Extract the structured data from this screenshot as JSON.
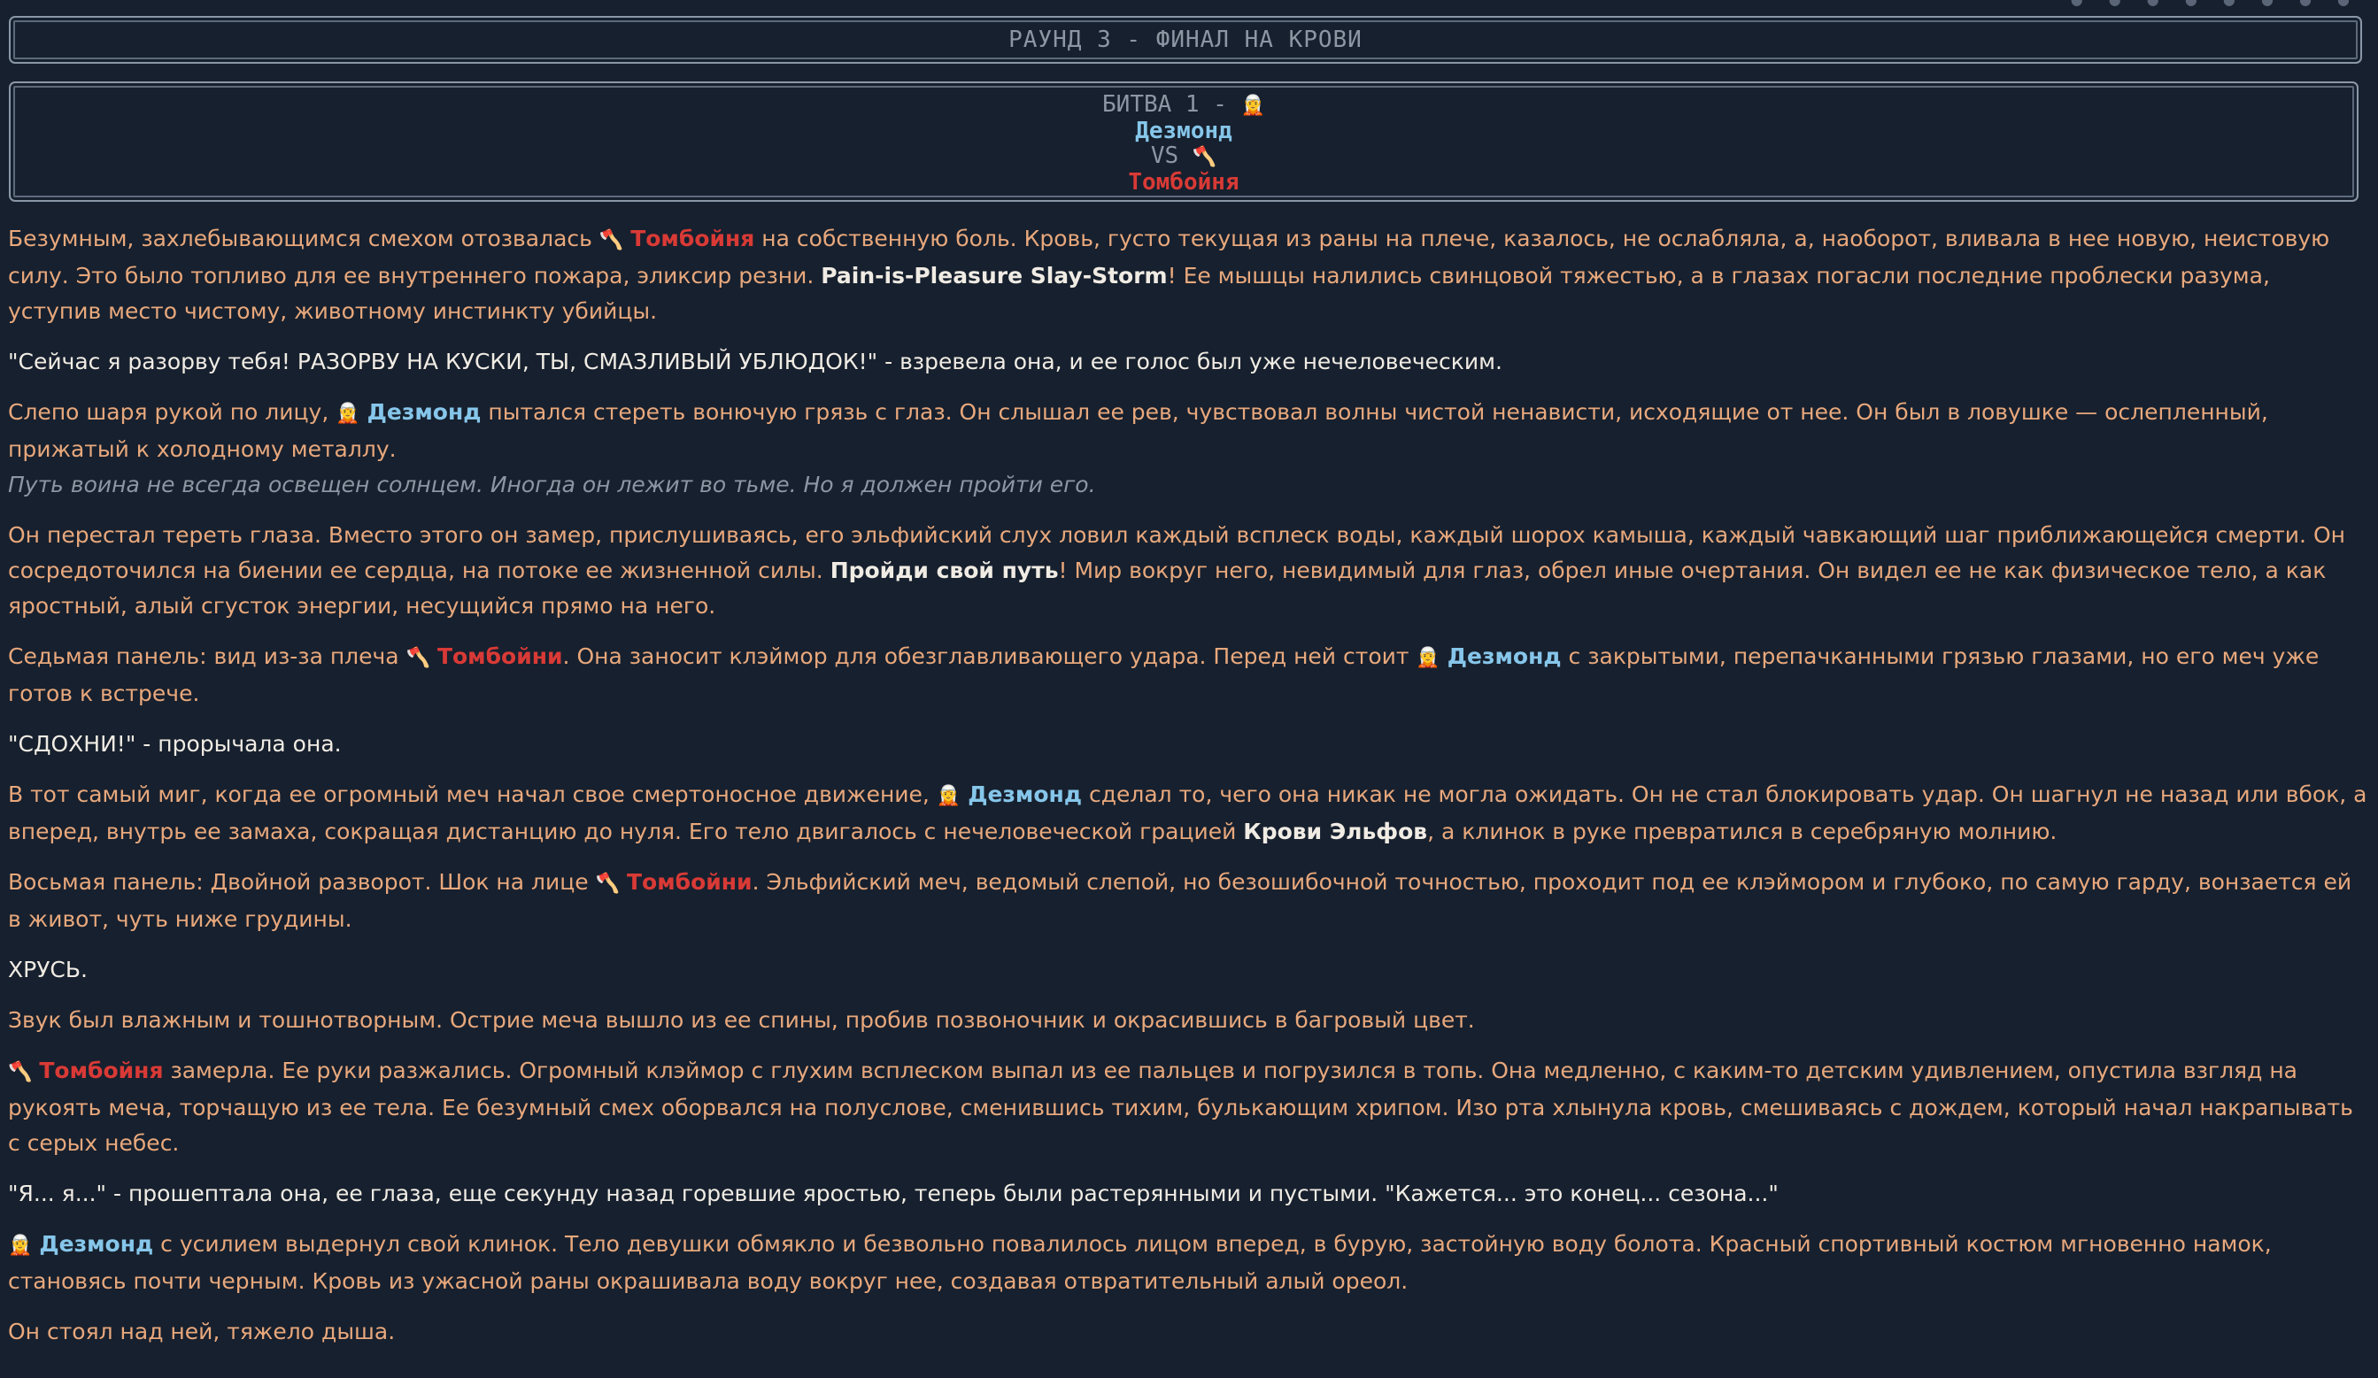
{
  "header": {
    "round_title": "РАУНД 3 - ФИНАЛ НА КРОВИ",
    "battle_label": "БИТВА 1 - ",
    "fighter_a_icon": "🧝",
    "fighter_a": "Дезмонд",
    "vs": "VS",
    "fighter_b_icon": "🪓",
    "fighter_b": "Томбойня"
  },
  "story": {
    "p1": {
      "a": "Безумным, захлебывающимся смехом отозвалась ",
      "icon": "🪓",
      "name": "Томбойня",
      "b": " на собственную боль. Кровь, густо текущая из раны на плече, казалось, не ослабляла, а, наоборот, вливала в нее новую, неистовую силу. Это было топливо для ее внутреннего пожара, эликсир резни. ",
      "bold": "Pain-is-Pleasure Slay-Storm",
      "c": "! Ее мышцы налились свинцовой тяжестью, а в глазах погасли последние проблески разума, уступив место чистому, животному инстинкту убийцы."
    },
    "p2": "\"Сейчас я разорву тебя! РАЗОРВУ НА КУСКИ, ТЫ, СМАЗЛИВЫЙ УБЛЮДОК!\" - взревела она, и ее голос был уже нечеловеческим.",
    "p3": {
      "a": "Слепо шаря рукой по лицу, ",
      "icon": "🧝",
      "name": "Дезмонд",
      "b": " пытался стереть вонючую грязь с глаз. Он слышал ее рев, чувствовал волны чистой ненависти, исходящие от нее. Он был в ловушке — ослепленный, прижатый к холодному металлу."
    },
    "p3_thought": "Путь воина не всегда освещен солнцем. Иногда он лежит во тьме. Но я должен пройти его.",
    "p4": {
      "a": "Он перестал тереть глаза. Вместо этого он замер, прислушиваясь, его эльфийский слух ловил каждый всплеск воды, каждый шорох камыша, каждый чавкающий шаг приближающейся смерти. Он сосредоточился на биении ее сердца, на потоке ее жизненной силы. ",
      "bold": "Пройди свой путь",
      "b": "! Мир вокруг него, невидимый для глаз, обрел иные очертания. Он видел ее не как физическое тело, а как яростный, алый сгусток энергии, несущийся прямо на него."
    },
    "p5": {
      "a": "Седьмая панель: вид из-за плеча ",
      "icon_b": "🪓",
      "name_b": "Томбойни",
      "b": ". Она заносит клэймор для обезглавливающего удара. Перед ней стоит ",
      "icon_a": "🧝",
      "name_a": "Дезмонд",
      "c": " с закрытыми, перепачканными грязью глазами, но его меч уже готов к встрече."
    },
    "p6": "\"СДОХНИ!\" - прорычала она.",
    "p7": {
      "a": "В тот самый миг, когда ее огромный меч начал свое смертоносное движение, ",
      "icon": "🧝",
      "name": "Дезмонд",
      "b": " сделал то, чего она никак не могла ожидать. Он не стал блокировать удар. Он шагнул не назад или вбок, а вперед, внутрь ее замаха, сокращая дистанцию до нуля. Его тело двигалось с нечеловеческой грацией ",
      "bold": "Крови Эльфов",
      "c": ", а клинок в руке превратился в серебряную молнию."
    },
    "p8": {
      "a": "Восьмая панель: Двойной разворот. Шок на лице ",
      "icon": "🪓",
      "name": "Томбойни",
      "b": ". Эльфийский меч, ведомый слепой, но безошибочной точностью, проходит под ее клэймором и глубоко, по самую гарду, вонзается ей в живот, чуть ниже грудины."
    },
    "p9": "ХРУСЬ.",
    "p10": "Звук был влажным и тошнотворным. Острие меча вышло из ее спины, пробив позвоночник и окрасившись в багровый цвет.",
    "p11": {
      "icon": "🪓",
      "name": "Томбойня",
      "a": " замерла. Ее руки разжались. Огромный клэймор с глухим всплеском выпал из ее пальцев и погрузился в топь. Она медленно, с каким-то детским удивлением, опустила взгляд на рукоять меча, торчащую из ее тела. Ее безумный смех оборвался на полуслове, сменившись тихим, булькающим хрипом. Изо рта хлынула кровь, смешиваясь с дождем, который начал накрапывать с серых небес."
    },
    "p12": "\"Я... я...\" - прошептала она, ее глаза, еще секунду назад горевшие яростью, теперь были растерянными и пустыми. \"Кажется... это конец... сезона...\"",
    "p13": {
      "icon": "🧝",
      "name": "Дезмонд",
      "a": " с усилием выдернул свой клинок. Тело девушки обмякло и безвольно повалилось лицом вперед, в бурую, застойную воду болота. Красный спортивный костюм мгновенно намок, становясь почти черным. Кровь из ужасной раны окрашивала воду вокруг нее, создавая отвратительный алый ореол."
    },
    "p14": "Он стоял над ней, тяжело дыша."
  }
}
